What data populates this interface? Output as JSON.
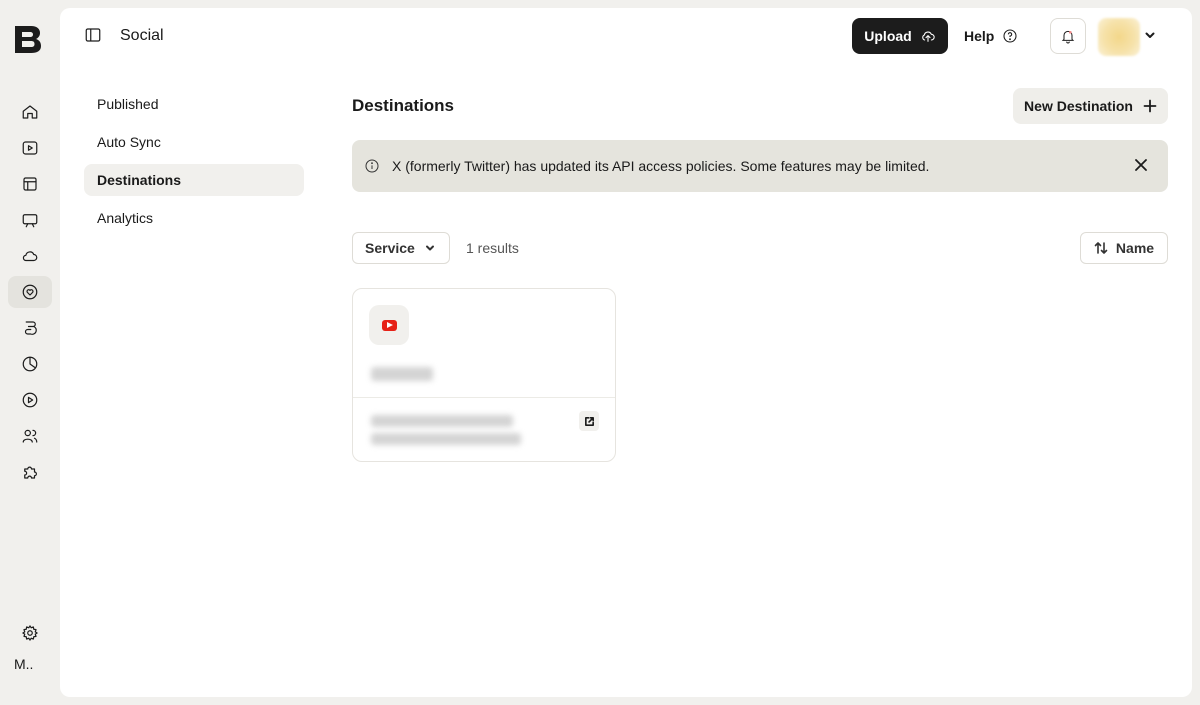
{
  "rail": {
    "user_initial": "M..",
    "items": [
      {
        "icon": "home-icon"
      },
      {
        "icon": "video-icon"
      },
      {
        "icon": "layout-icon"
      },
      {
        "icon": "monitor-icon"
      },
      {
        "icon": "cloud-icon"
      },
      {
        "icon": "social-heart-icon",
        "active": true
      },
      {
        "icon": "brand-icon"
      },
      {
        "icon": "analytics-pie-icon"
      },
      {
        "icon": "play-circle-icon"
      },
      {
        "icon": "users-icon"
      },
      {
        "icon": "puzzle-icon"
      },
      {
        "icon": "settings-icon"
      }
    ]
  },
  "header": {
    "title": "Social",
    "upload_label": "Upload",
    "help_label": "Help"
  },
  "subnav": {
    "items": [
      {
        "label": "Published"
      },
      {
        "label": "Auto Sync"
      },
      {
        "label": "Destinations",
        "active": true
      },
      {
        "label": "Analytics"
      }
    ]
  },
  "main": {
    "section_title": "Destinations",
    "new_destination_label": "New Destination",
    "banner_text": "X (formerly Twitter) has updated its API access policies. Some features may be limited.",
    "filter_label": "Service",
    "results_count": "1 results",
    "sort_label": "Name",
    "cards": [
      {
        "service_icon": "youtube-icon"
      }
    ]
  },
  "colors": {
    "page_bg": "#f1f0ed",
    "panel_bg": "#ffffff",
    "primary_button": "#1c1c1c",
    "banner_bg": "#e5e4dd",
    "youtube_red": "#e62117"
  }
}
